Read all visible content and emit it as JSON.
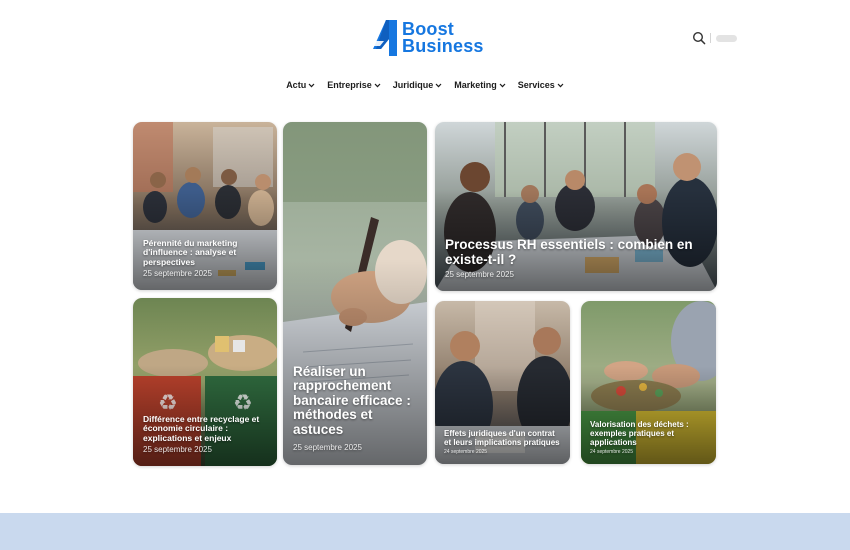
{
  "brand": {
    "line1": "Boost",
    "line2": "Business",
    "color": "#1677e0"
  },
  "header_icons": {
    "search": "search-icon",
    "theme_toggle": "toggle-pill"
  },
  "nav": {
    "items": [
      {
        "label": "Actu"
      },
      {
        "label": "Entreprise"
      },
      {
        "label": "Juridique"
      },
      {
        "label": "Marketing"
      },
      {
        "label": "Services"
      }
    ]
  },
  "articles": [
    {
      "title": "Pérennité du marketing d'influence : analyse et perspectives",
      "date": "25 septembre 2025"
    },
    {
      "title": "Réaliser un rapprochement bancaire efficace : méthodes et astuces",
      "date": "25 septembre 2025"
    },
    {
      "title": "Processus RH essentiels : combien en existe-t-il ?",
      "date": "25 septembre 2025"
    },
    {
      "title": "Différence entre recyclage et économie circulaire : explications et enjeux",
      "date": "25 septembre 2025"
    },
    {
      "title": "Effets juridiques d'un contrat et leurs implications pratiques",
      "date": "24 septembre 2025"
    },
    {
      "title": "Valorisation des déchets : exemples pratiques et applications",
      "date": "24 septembre 2025"
    }
  ],
  "colors": {
    "footer_band": "#c9d9ee",
    "nav_text": "#1d1d1d"
  }
}
